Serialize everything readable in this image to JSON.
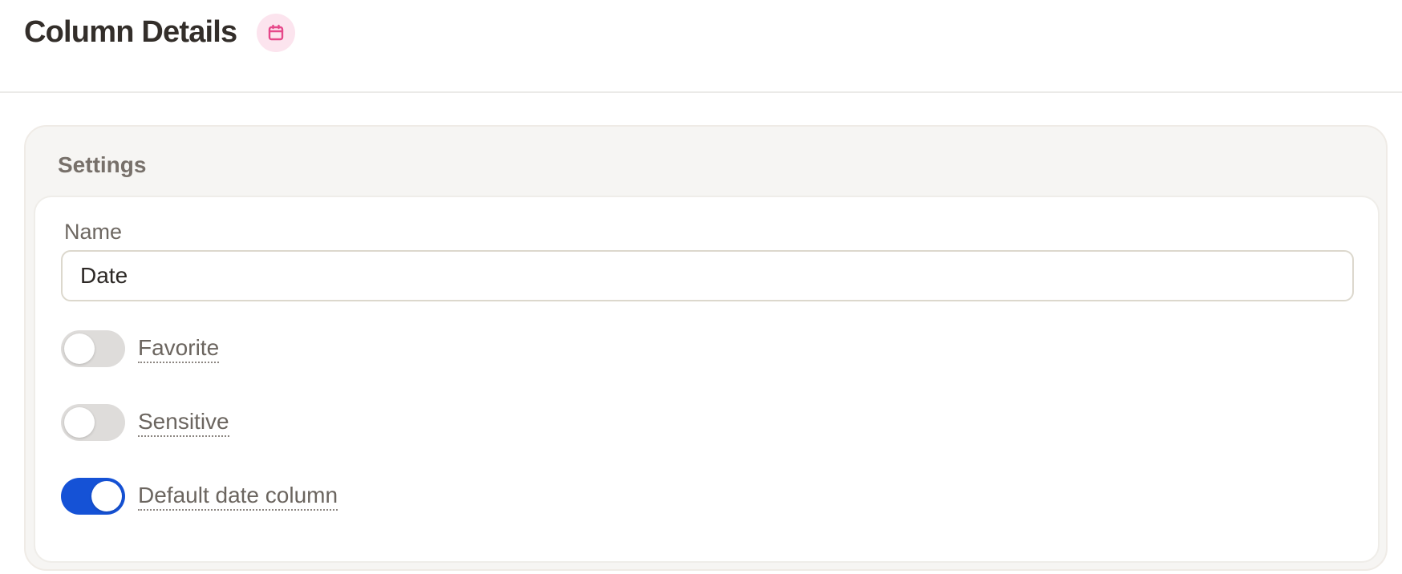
{
  "header": {
    "title": "Column Details",
    "icon": "calendar-icon",
    "icon_color": "#e6488a",
    "icon_bg": "#fce4ee"
  },
  "settings": {
    "title": "Settings",
    "name_label": "Name",
    "name_value": "Date",
    "toggles": [
      {
        "label": "Favorite",
        "on": false
      },
      {
        "label": "Sensitive",
        "on": false
      },
      {
        "label": "Default date column",
        "on": true
      }
    ]
  },
  "colors": {
    "toggle_on": "#1552d6",
    "toggle_off": "#dedcda"
  }
}
